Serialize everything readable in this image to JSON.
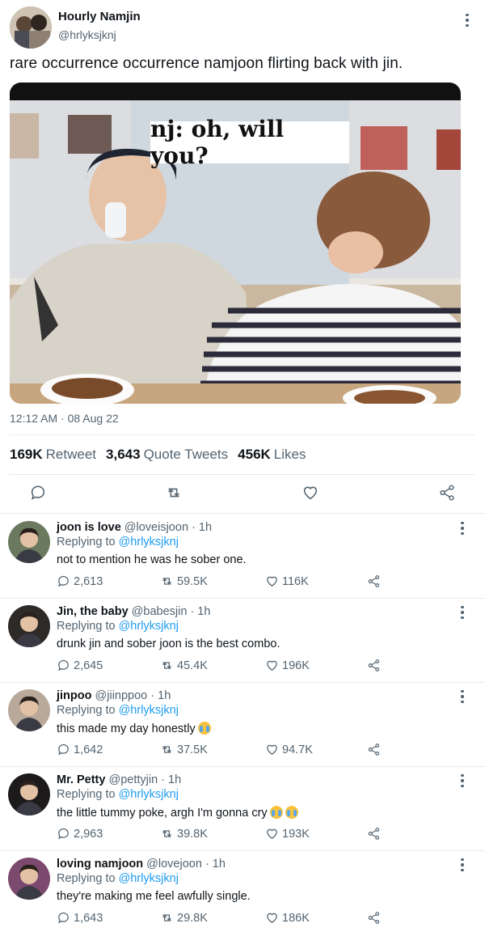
{
  "tweet": {
    "author_name": "Hourly Namjin",
    "author_handle": "@hrlyksjknj",
    "text": "rare occurrence occurrence namjoon flirting back with jin.",
    "image_caption": "nj: oh, will you?",
    "timestamp": "12:12 AM · 08 Aug 22",
    "stats": {
      "retweets": "169K",
      "retweets_label": "Retweet",
      "quotes": "3,643",
      "quotes_label": "Quote Tweets",
      "likes": "456K",
      "likes_label": "Likes"
    },
    "actions": [
      "reply-icon",
      "retweet-icon",
      "like-icon",
      "share-icon"
    ]
  },
  "replies": [
    {
      "name": "joon is love",
      "handle": "@loveisjoon",
      "time": "· 1h",
      "replying_prefix": "Replying to",
      "replying_to": "@hrlyksjknj",
      "text": "not to mention he was he sober one.",
      "emoji_count": 0,
      "replies": "2,613",
      "retweets": "59.5K",
      "likes": "116K",
      "avatar_color": "#6b7a5e"
    },
    {
      "name": "Jin, the baby",
      "handle": "@babesjin",
      "time": "· 1h",
      "replying_prefix": "Replying to",
      "replying_to": "@hrlyksjknj",
      "text": "drunk jin and sober joon is the best combo.",
      "emoji_count": 0,
      "replies": "2,645",
      "retweets": "45.4K",
      "likes": "196K",
      "avatar_color": "#2d2a28"
    },
    {
      "name": "jinpoo",
      "handle": "@jiinppoo",
      "time": "· 1h",
      "replying_prefix": "Replying to",
      "replying_to": "@hrlyksjknj",
      "text": "this made my day honestly",
      "emoji_count": 1,
      "replies": "1,642",
      "retweets": "37.5K",
      "likes": "94.7K",
      "avatar_color": "#b9a99a"
    },
    {
      "name": "Mr. Petty",
      "handle": "@pettyjin",
      "time": "· 1h",
      "replying_prefix": "Replying to",
      "replying_to": "@hrlyksjknj",
      "text": "the little tummy poke, argh I'm gonna cry",
      "emoji_count": 2,
      "replies": "2,963",
      "retweets": "39.8K",
      "likes": "193K",
      "avatar_color": "#1d1a1c"
    },
    {
      "name": "loving namjoon",
      "handle": "@lovejoon",
      "time": "· 1h",
      "replying_prefix": "Replying to",
      "replying_to": "@hrlyksjknj",
      "text": "they're making me feel awfully single.",
      "emoji_count": 0,
      "replies": "1,643",
      "retweets": "29.8K",
      "likes": "186K",
      "avatar_color": "#7c4a6e"
    }
  ],
  "colors": {
    "link": "#1d9bf0",
    "muted": "#536471",
    "divider": "#e6ecf0"
  }
}
